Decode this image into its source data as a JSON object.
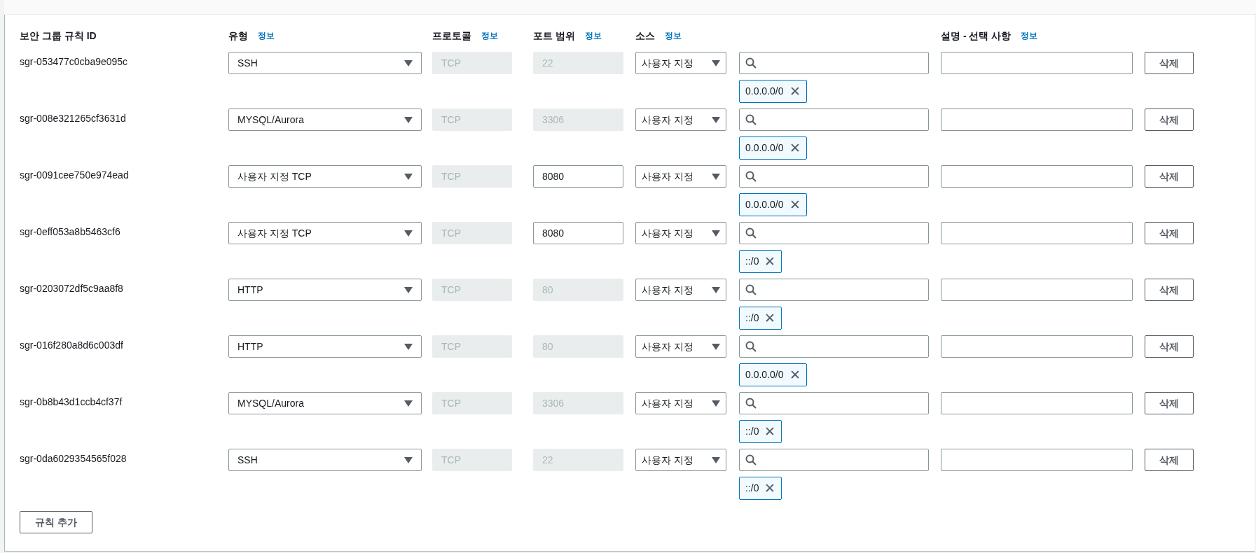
{
  "columns": [
    {
      "label": "보안 그룹 규칙 ID"
    },
    {
      "label": "유형",
      "info": "정보"
    },
    {
      "label": "프로토콜",
      "info": "정보"
    },
    {
      "label": "포트 범위",
      "info": "정보"
    },
    {
      "label": "소스",
      "info": "정보"
    },
    {},
    {
      "label": "설명 - 선택 사항",
      "info": "정보"
    }
  ],
  "rules": [
    {
      "id": "sgr-053477c0cba9e095c",
      "type": "SSH",
      "protocol": {
        "value": "TCP",
        "disabled": true
      },
      "port": {
        "value": "22",
        "disabled": true
      },
      "source": "사용자 지정",
      "cidr": "0.0.0.0/0",
      "remove_chip": "✕",
      "delete": "삭제"
    },
    {
      "id": "sgr-008e321265cf3631d",
      "type": "MYSQL/Aurora",
      "protocol": {
        "value": "TCP",
        "disabled": true
      },
      "port": {
        "value": "3306",
        "disabled": true
      },
      "source": "사용자 지정",
      "cidr": "0.0.0.0/0",
      "remove_chip": "✕",
      "delete": "삭제"
    },
    {
      "id": "sgr-0091cee750e974ead",
      "type": "사용자 지정 TCP",
      "protocol": {
        "value": "TCP",
        "disabled": true
      },
      "port": {
        "value": "8080",
        "disabled": false
      },
      "source": "사용자 지정",
      "cidr": "0.0.0.0/0",
      "remove_chip": "✕",
      "delete": "삭제"
    },
    {
      "id": "sgr-0eff053a8b5463cf6",
      "type": "사용자 지정 TCP",
      "protocol": {
        "value": "TCP",
        "disabled": true
      },
      "port": {
        "value": "8080",
        "disabled": false
      },
      "source": "사용자 지정",
      "cidr": "::/0",
      "remove_chip": "✕",
      "delete": "삭제"
    },
    {
      "id": "sgr-0203072df5c9aa8f8",
      "type": "HTTP",
      "protocol": {
        "value": "TCP",
        "disabled": true
      },
      "port": {
        "value": "80",
        "disabled": true
      },
      "source": "사용자 지정",
      "cidr": "::/0",
      "remove_chip": "✕",
      "delete": "삭제"
    },
    {
      "id": "sgr-016f280a8d6c003df",
      "type": "HTTP",
      "protocol": {
        "value": "TCP",
        "disabled": true
      },
      "port": {
        "value": "80",
        "disabled": true
      },
      "source": "사용자 지정",
      "cidr": "0.0.0.0/0",
      "remove_chip": "✕",
      "delete": "삭제"
    },
    {
      "id": "sgr-0b8b43d1ccb4cf37f",
      "type": "MYSQL/Aurora",
      "protocol": {
        "value": "TCP",
        "disabled": true
      },
      "port": {
        "value": "3306",
        "disabled": true
      },
      "source": "사용자 지정",
      "cidr": "::/0",
      "remove_chip": "✕",
      "delete": "삭제"
    },
    {
      "id": "sgr-0da6029354565f028",
      "type": "SSH",
      "protocol": {
        "value": "TCP",
        "disabled": true
      },
      "port": {
        "value": "22",
        "disabled": true
      },
      "source": "사용자 지정",
      "cidr": "::/0",
      "remove_chip": "✕",
      "delete": "삭제"
    }
  ],
  "add_button": "규칙 추가"
}
